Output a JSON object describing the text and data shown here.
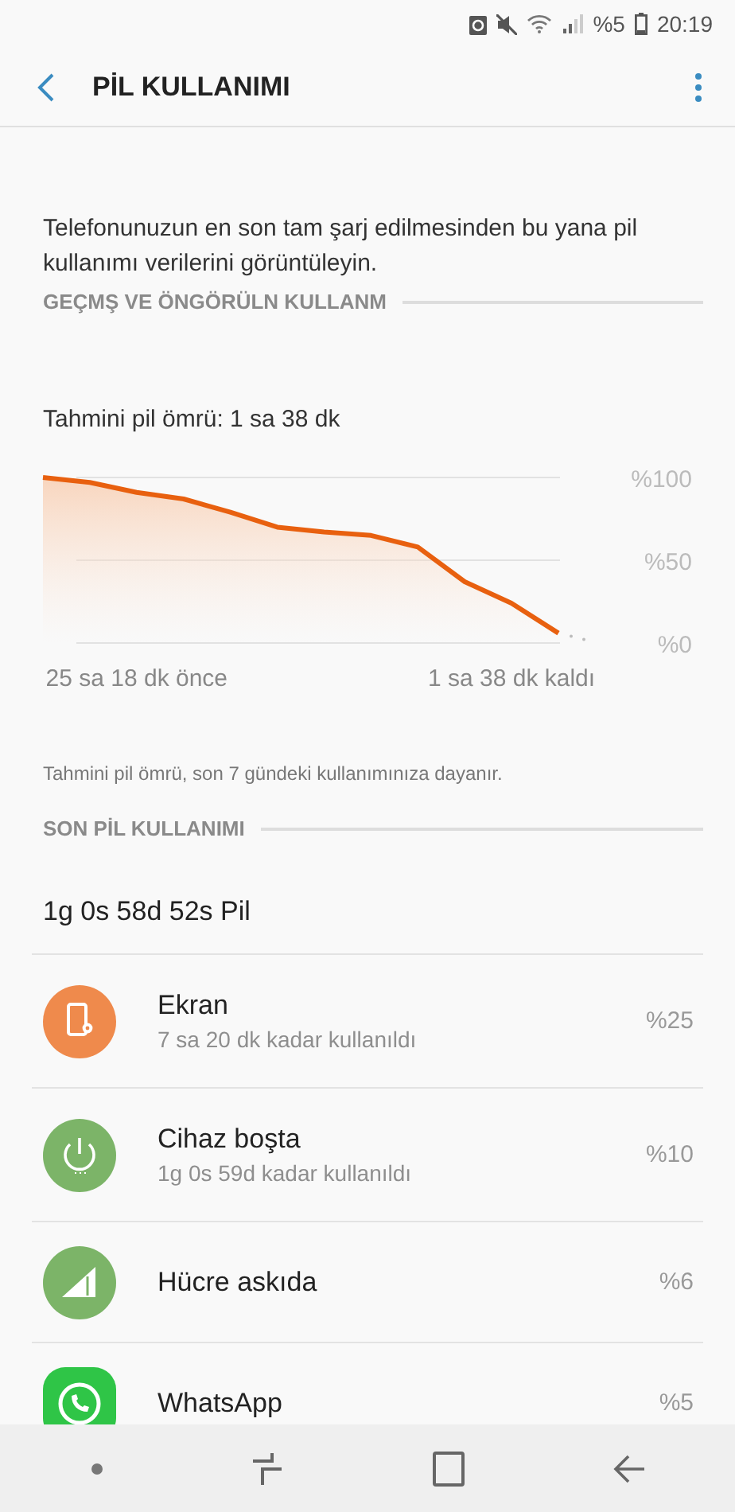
{
  "status_bar": {
    "battery_percent": "%5",
    "time": "20:19"
  },
  "app_bar": {
    "title": "PİL KULLANIMI"
  },
  "description": "Telefonunuzun en son tam şarj edilmesinden bu yana pil kullanımı verilerini görüntüleyin.",
  "history_section": {
    "header": "GEÇMŞ VE ÖNGÖRÜLN KULLANM",
    "estimate": "Tahmini pil ömrü: 1 sa 38 dk",
    "chart_data": {
      "type": "area",
      "categories": [
        null,
        null,
        "25 sa 18 dk önce",
        null,
        null,
        null,
        null,
        null,
        null,
        null,
        "1 sa 38 dk kaldı",
        null
      ],
      "series": [
        {
          "color": "#e8600f",
          "values": [
            100,
            97,
            91,
            87,
            79,
            70,
            67,
            65,
            58,
            37,
            24,
            6
          ]
        }
      ],
      "ylim": [
        0,
        100
      ],
      "yticks": [
        {
          "value": 0,
          "label": "%0"
        },
        {
          "value": 50,
          "label": "%50"
        },
        {
          "value": 100,
          "label": "%100"
        }
      ]
    },
    "footnote": "Tahmini pil ömrü, son 7 gündeki kullanımınıza dayanır."
  },
  "recent_section": {
    "header": "SON PİL KULLANIMI",
    "total": "1g 0s 58d 52s Pil",
    "items": [
      {
        "kind": "screen",
        "color": "#ef8a4c",
        "name": "Ekran",
        "detail": "7 sa 20 dk kadar kullanıldı",
        "percent": "%25"
      },
      {
        "kind": "idle",
        "color": "#7cb468",
        "name": "Cihaz boşta",
        "detail": "1g 0s 59d kadar kullanıldı",
        "percent": "%10"
      },
      {
        "kind": "cell",
        "color": "#7cb468",
        "name": "Hücre askıda",
        "percent": "%6"
      },
      {
        "kind": "whatsapp",
        "color": "#2fc547",
        "name": "WhatsApp",
        "percent": "%5"
      }
    ]
  }
}
